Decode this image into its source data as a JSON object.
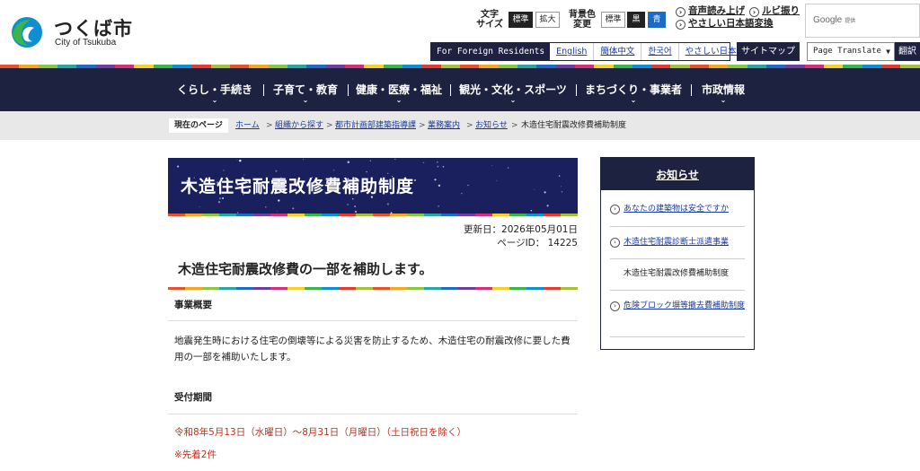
{
  "colors": {
    "navy": "#1d2240",
    "banner": "#1a1f5e",
    "link": "#1a3aa0",
    "red_text": "#c0301a",
    "stripe": [
      "#e4532c",
      "#f5a623",
      "#8cc63f",
      "#2aa5a0",
      "#1d6bc4",
      "#6a3fa0",
      "#d2307a",
      "#f2d12c",
      "#3ab54a",
      "#0d8fd1",
      "#e33b2f",
      "#a5c13a"
    ]
  },
  "header": {
    "logo_jp": "つくば市",
    "logo_en": "City of Tsukuba",
    "logo_icon": "tsukuba-city-emblem",
    "font_size_label": "文字\nサイズ",
    "font_size_options": [
      "標準",
      "拡大"
    ],
    "bg_color_label": "背景色\n変更",
    "bg_color_options": [
      "標準",
      "黒",
      "青"
    ],
    "links": [
      "音声読み上げ",
      "ルビ振り",
      "やさしい日本語変換"
    ],
    "google_label": "Google",
    "google_sub": "提供",
    "foreign_head": "For Foreign Residents",
    "languages": [
      "English",
      "簡体中文",
      "한국어",
      "やさしい日本語"
    ],
    "sitemap": "サイトマップ",
    "translate_value": "Page Translate",
    "translate_button": "翻訳"
  },
  "nav": {
    "items": [
      "くらし・手続き",
      "子育て・教育",
      "健康・医療・福祉",
      "観光・文化・スポーツ",
      "まちづくり・事業者",
      "市政情報"
    ]
  },
  "breadcrumb": {
    "label": "現在のページ",
    "items": [
      "ホーム",
      "組織から探す",
      "都市計画部建築指導課",
      "業務案内",
      "お知らせ"
    ],
    "current": "木造住宅耐震改修費補助制度"
  },
  "main": {
    "title": "木造住宅耐震改修費補助制度",
    "updated": "更新日：2026年05月01日",
    "page_id": "ページID： 14225",
    "heading": "木造住宅耐震改修費の一部を補助します。",
    "section1_title": "事業概要",
    "section1_body": "地震発生時における住宅の倒壊等による災害を防止するため、木造住宅の耐震改修に要した費用の一部を補助いたします。",
    "section2_title": "受付期間",
    "period": "令和8年5月13日（水曜日）～8月31日（月曜日）（土日祝日を除く）",
    "note": "※先着2件"
  },
  "sidebar": {
    "title": "お知らせ",
    "items": [
      {
        "label": "あなたの建築物は安全ですか",
        "current": false
      },
      {
        "label": "木造住宅耐震診断士派遣事業",
        "current": false
      },
      {
        "label": "木造住宅耐震改修費補助制度",
        "current": true
      },
      {
        "label": "危険ブロック塀等撤去費補助制度",
        "current": false
      }
    ]
  }
}
